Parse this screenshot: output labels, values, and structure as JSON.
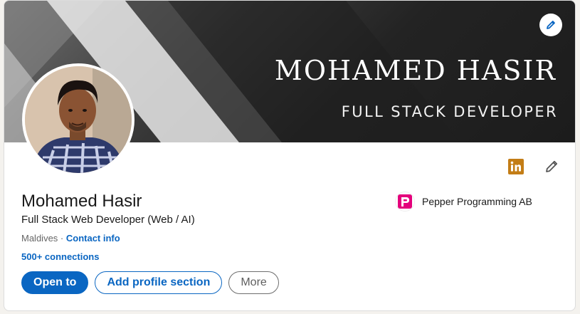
{
  "banner": {
    "title": "MOHAMED HASIR",
    "subtitle": "FULL STACK DEVELOPER"
  },
  "profile": {
    "name": "Mohamed Hasir",
    "headline": "Full Stack Web Developer (Web / AI)",
    "location": "Maldives",
    "separator": " · ",
    "contact_info_label": "Contact info",
    "connections": "500+ connections"
  },
  "company": {
    "name": "Pepper Programming AB",
    "logo_letter": "P"
  },
  "actions": {
    "open_to": "Open to",
    "add_section": "Add profile section",
    "more": "More"
  },
  "colors": {
    "accent": "#0a66c2",
    "linkedin_badge": "#c37d16",
    "company_brand": "#e4007c"
  },
  "icons": {
    "edit_banner": "pencil-icon",
    "linkedin": "linkedin-icon",
    "edit_intro": "pencil-icon"
  }
}
